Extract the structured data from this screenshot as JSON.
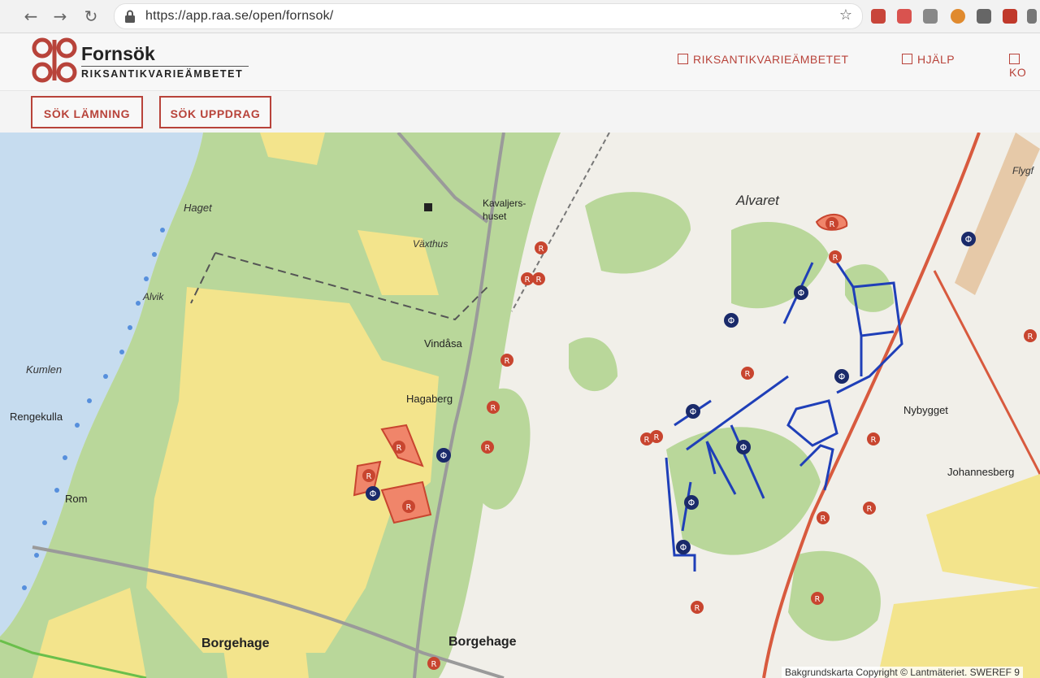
{
  "browser": {
    "url": "https://app.raa.se/open/fornsok/"
  },
  "header": {
    "title": "Fornsök",
    "subtitle": "RIKSANTIKVARIEÄMBETET",
    "links": [
      "RIKSANTIKVARIEÄMBETET",
      "HJÄLP",
      "KO"
    ]
  },
  "toolbar": {
    "search_remains": "SÖK LÄMNING",
    "search_assignments": "SÖK UPPDRAG"
  },
  "map": {
    "place_labels": [
      "Haget",
      "Alvik",
      "Kumlen",
      "Rengekulla",
      "Rom",
      "Växthus",
      "Kavaljers-",
      "huset",
      "Vindåsa",
      "Hagaberg",
      "Borgehage",
      "Borgehage",
      "Alvaret",
      "Nybygget",
      "Johannesberg",
      "Flygf"
    ],
    "copyright": "Bakgrundskarta Copyright © Lantmäteriet. SWEREF 9"
  },
  "colors": {
    "accent": "#b8433a",
    "water": "#c6dcef",
    "forest": "#b9d79a",
    "field": "#f3e48c",
    "marker_red": "#c8452f",
    "marker_blue": "#1a2a6a"
  }
}
